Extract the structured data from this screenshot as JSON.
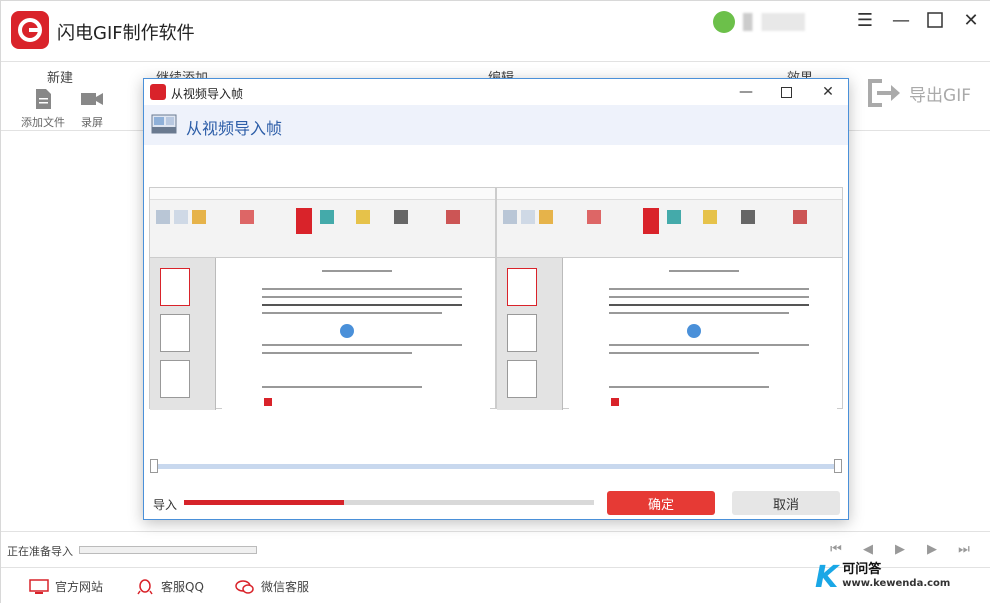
{
  "app": {
    "title": "闪电GIF制作软件"
  },
  "toolbar": {
    "groups": {
      "new": "新建",
      "continue_add": "继续添加",
      "edit": "编辑",
      "effect": "效果"
    },
    "add_file_label": "添加文件",
    "record_label": "录屏",
    "export_label": "导出GIF"
  },
  "status": {
    "text": "正在准备导入"
  },
  "footer": {
    "website": "官方网站",
    "qq": "客服QQ",
    "wechat": "微信客服"
  },
  "watermark": {
    "letter": "K",
    "cn": "可问答",
    "url": "www.kewenda.com"
  },
  "dialog": {
    "title": "从视频导入帧",
    "header_title": "从视频导入帧",
    "import_label": "导入",
    "import_progress": 0.39,
    "confirm_label": "确定",
    "cancel_label": "取消"
  },
  "colors": {
    "brand_red": "#d9232a",
    "button_red": "#e63a35",
    "header_blue": "#2d5ea8"
  }
}
